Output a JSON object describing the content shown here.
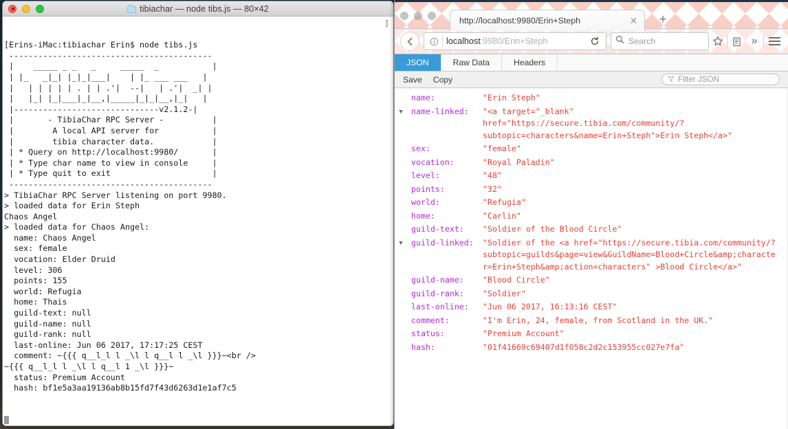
{
  "terminal": {
    "title": "tibiachar — node tibs.js — 80×42",
    "folder_icon": "folder-icon",
    "lights": [
      "close",
      "minimize",
      "maximize"
    ],
    "right_bracket": "]",
    "lines": [
      "[Erins-iMac:tibiachar Erin$ node tibs.js",
      " ------------------------------------------",
      " |    _____ _ _   _     _____  _           |",
      " | |_   _|_| |_|_|___|    | |_ ___ ___   |",
      " |   | | | | | . | | .'|  --|   | .'|  _| |",
      " |   |_| |_|___|_|__,|_____|_|_|__,|_|   |",
      " |------------------------------v2.1.2-|",
      " |       - TibiaChar RPC Server -          |",
      " |        A local API server for           |",
      " |        tibia character data.            |",
      " | * Query on http://localhost:9980/       |",
      " | * Type char name to view in console     |",
      " | * Type quit to exit                     |",
      " ------------------------------------------",
      "> TibiaChar RPC Server listening on port 9980.",
      "> loaded data for Erin Steph",
      "Chaos Angel",
      "> loaded data for Chaos Angel:",
      "  name: Chaos Angel",
      "  sex: female",
      "  vocation: Elder Druid",
      "  level: 306",
      "  points: 155",
      "  world: Refugia",
      "  home: Thais",
      "  guild-text: null",
      "  guild-name: null",
      "  guild-rank: null",
      "  last-online: Jun 06 2017, 17:17:25 CEST",
      "  comment: ~{{{ q__l_l l _\\l l q__l l _\\l }}}~<br />",
      "~{{{ q__l_l l _\\l l q__l 1 _\\l }}}~",
      "  status: Premium Account",
      "  hash: bf1e5a3aa19136ab8b15fd7f43d6263d1e1af7c5"
    ]
  },
  "browser": {
    "tab": {
      "title": "http://localhost:9980/Erin+Steph",
      "close_label": "✕"
    },
    "new_tab_label": "+",
    "nav": {
      "back_label": "←",
      "identity_label": "ⓘ",
      "url_host": "localhost",
      "url_path": ":9980/Erin+Steph",
      "url_full": "localhost:9980/Erin+Steph",
      "reload_label": "⟳",
      "search_placeholder": "Search",
      "bookmark_label": "☆",
      "library_label": "▤",
      "overflow_label": "»",
      "menu_label": "menu"
    },
    "json_viewer": {
      "tabs": [
        {
          "label": "JSON",
          "active": true
        },
        {
          "label": "Raw Data",
          "active": false
        },
        {
          "label": "Headers",
          "active": false
        }
      ],
      "actions": [
        "Save",
        "Copy"
      ],
      "filter_placeholder": "Filter JSON",
      "rows": [
        {
          "key": "name:",
          "value": "\"Erin Steph\"",
          "twisty": ""
        },
        {
          "key": "name-linked:",
          "value": "\"<a target=\"_blank\" href=\"https://secure.tibia.com/community/?subtopic=characters&name=Erin+Steph\">Erin Steph</a>\"",
          "twisty": "▼"
        },
        {
          "key": "sex:",
          "value": "\"female\"",
          "twisty": ""
        },
        {
          "key": "vocation:",
          "value": "\"Royal Paladin\"",
          "twisty": ""
        },
        {
          "key": "level:",
          "value": "\"48\"",
          "twisty": ""
        },
        {
          "key": "points:",
          "value": "\"32\"",
          "twisty": ""
        },
        {
          "key": "world:",
          "value": "\"Refugia\"",
          "twisty": ""
        },
        {
          "key": "home:",
          "value": "\"Carlin\"",
          "twisty": ""
        },
        {
          "key": "guild-text:",
          "value": "\"Soldier of the Blood Circle\"",
          "twisty": ""
        },
        {
          "key": "guild-linked:",
          "value": "\"Soldier of the <a href=\"https://secure.tibia.com/community/?subtopic=guilds&page=view&GuildName=Blood+Circle&amp;character=Erin+Steph&amp;action=characters\" >Blood Circle</a>\"",
          "twisty": "▼"
        },
        {
          "key": "guild-name:",
          "value": "\"Blood Circle\"",
          "twisty": ""
        },
        {
          "key": "guild-rank:",
          "value": "\"Soldier\"",
          "twisty": ""
        },
        {
          "key": "last-online:",
          "value": "\"Jun 06 2017, 16:13:16 CEST\"",
          "twisty": ""
        },
        {
          "key": "comment:",
          "value": "\"I'm Erin, 24, female, from Scotland in the UK.\"",
          "twisty": ""
        },
        {
          "key": "status:",
          "value": "\"Premium Account\"",
          "twisty": ""
        },
        {
          "key": "hash:",
          "value": "\"01f41669c69407d1f058c2d2c153955cc027e7fa\"",
          "twisty": ""
        }
      ]
    }
  },
  "colors": {
    "json_key": "#b429d9",
    "json_value": "#ec4034",
    "tab_active": "#3a9bd9",
    "theme_pink": "#f8cfc4",
    "desktop": "#1d3347"
  }
}
